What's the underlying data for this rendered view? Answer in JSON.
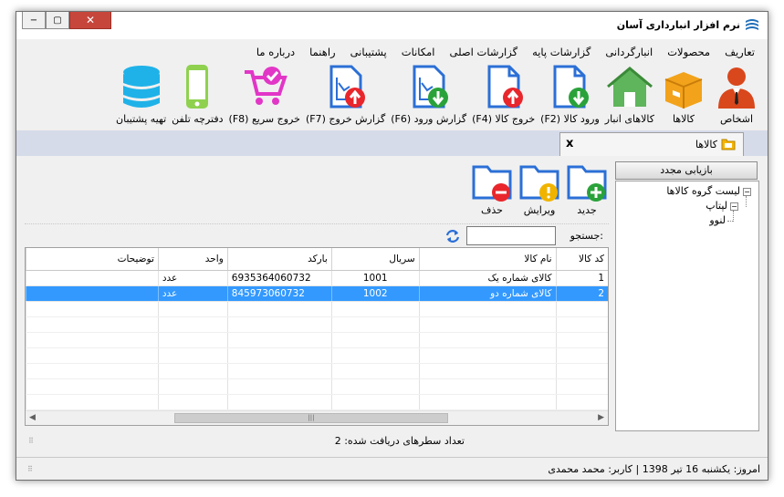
{
  "window": {
    "title": "نرم افزار انبارداری آسان",
    "minimize": "−",
    "maximize": "▢",
    "close": "✕"
  },
  "menu": [
    "تعاریف",
    "محصولات",
    "انبارگردانی",
    "گزارشات پایه",
    "گزارشات اصلی",
    "امکانات",
    "پشتیبانی",
    "راهنما",
    "درباره ما"
  ],
  "ribbon": [
    {
      "label": "اشخاص",
      "icon": "person-icon"
    },
    {
      "label": "کالاها",
      "icon": "box-icon"
    },
    {
      "label": "کالاهای انبار",
      "icon": "warehouse-icon"
    },
    {
      "label": "ورود کالا (F2)",
      "icon": "document-in-icon"
    },
    {
      "label": "خروج کالا (F4)",
      "icon": "document-out-icon"
    },
    {
      "label": "گزارش ورود (F6)",
      "icon": "report-in-icon"
    },
    {
      "label": "گزارش خروج (F7)",
      "icon": "report-out-icon"
    },
    {
      "label": "خروج سریع (F8)",
      "icon": "cart-icon"
    },
    {
      "label": "دفترچه تلفن",
      "icon": "phone-icon"
    },
    {
      "label": "تهیه پشتیبان",
      "icon": "database-icon"
    }
  ],
  "tab": {
    "label": "کالاها",
    "close": "x"
  },
  "toolbar": {
    "new": "جدید",
    "edit": "ویرایش",
    "delete": "حذف"
  },
  "search": {
    "label": "جستجو:",
    "value": ""
  },
  "grid": {
    "columns": [
      "کد کالا",
      "نام کالا",
      "سریال",
      "بارکد",
      "واحد",
      "توضیحات"
    ],
    "rows": [
      {
        "code": "1",
        "name": "کالای شماره یک",
        "serial": "1001",
        "barcode": "6935364060732",
        "unit": "عدد",
        "desc": ""
      },
      {
        "code": "2",
        "name": "کالای شماره دو",
        "serial": "1002",
        "barcode": "845973060732",
        "unit": "عدد",
        "desc": ""
      }
    ],
    "selected_row": 2
  },
  "count": {
    "label": "تعداد سطرهای دریافت شده:",
    "value": "2"
  },
  "tree": {
    "refresh": "بازیابی مجدد",
    "root": "لیست گروه کالاها",
    "child": "لپتاپ",
    "grandchild": "لنوو"
  },
  "status": {
    "text": "امروز: یکشنبه 16 تیر 1398   |   کاربر: محمد محمدی"
  },
  "colors": {
    "selection": "#3399ff",
    "accent_red": "#e8262c",
    "accent_green": "#2aa23a",
    "doc_blue": "#2b6fd6"
  }
}
